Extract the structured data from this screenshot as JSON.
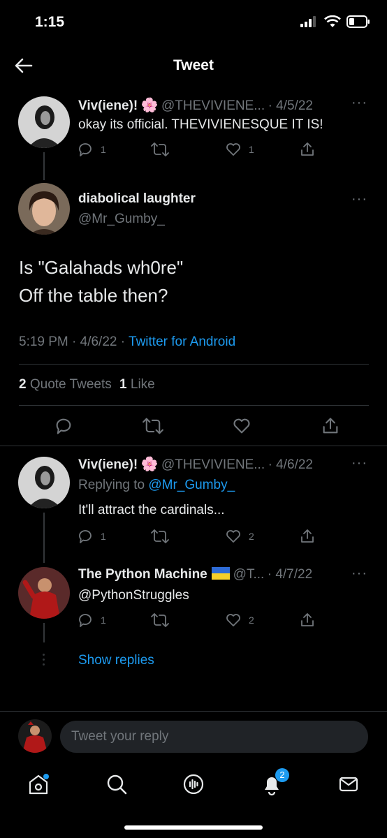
{
  "status_bar": {
    "time": "1:15"
  },
  "header": {
    "title": "Tweet"
  },
  "tweet1": {
    "name": "Viv(iene)!",
    "emoji": "🌸",
    "handle": "@THEVIVIENE...",
    "date": "· 4/5/22",
    "text": "okay its official. THEVIVIENESQUE IT IS!",
    "replies": "1",
    "likes": "1"
  },
  "main_tweet": {
    "name": "diabolical laughter",
    "handle": "@Mr_Gumby_",
    "line1": "Is \"Galahads wh0re\"",
    "line2": "Off the table then?",
    "time": "5:19 PM · 4/6/22 ·",
    "source": "Twitter for Android",
    "quote_count": "2",
    "quote_label": "Quote Tweets",
    "like_count": "1",
    "like_label": "Like"
  },
  "reply1": {
    "name": "Viv(iene)!",
    "emoji": "🌸",
    "handle": "@THEVIVIENE...",
    "date": "· 4/6/22",
    "replying_prefix": "Replying to",
    "replying_to": "@Mr_Gumby_",
    "text": "It'll attract the cardinals...",
    "replies": "1",
    "likes": "2"
  },
  "reply2": {
    "name": "The Python Machine",
    "handle": "@T...",
    "date": "· 4/7/22",
    "text": "@PythonStruggles",
    "replies": "1",
    "likes": "2"
  },
  "show_replies": "Show replies",
  "compose": {
    "placeholder": "Tweet your reply"
  },
  "tabbar": {
    "notification_count": "2"
  },
  "colors": {
    "accent": "#1d9bf0",
    "background": "#000000",
    "muted": "#71767b"
  }
}
